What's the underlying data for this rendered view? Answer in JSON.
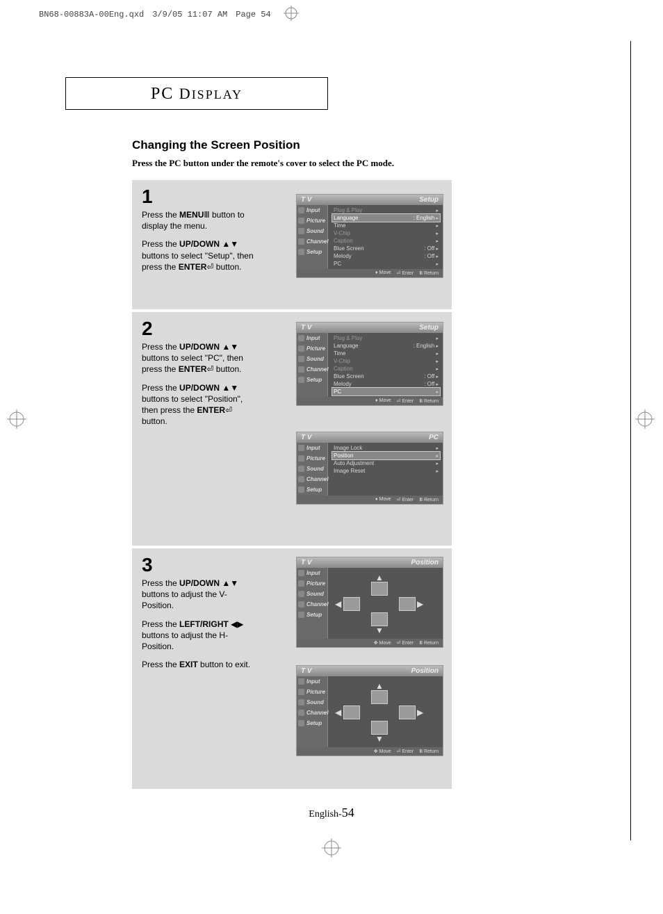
{
  "print_header": {
    "file": "BN68-00883A-00Eng.qxd",
    "date": "3/9/05 11:07 AM",
    "page_label": "Page 54"
  },
  "section_title": "PC Display",
  "subtitle": "Changing the Screen Position",
  "lead": "Press the PC button under the remote's cover to select the PC mode.",
  "footer": {
    "lang": "English-",
    "pn": "54"
  },
  "steps": {
    "s1": {
      "num": "1",
      "p1a": "Press the ",
      "p1b": "MENU",
      "p1c": " button to display the menu.",
      "p2a": "Press the ",
      "p2b": "UP/DOWN",
      "p2c": " buttons to select \"Setup\", then press the ",
      "p2d": "ENTER",
      "p2e": " button."
    },
    "s2": {
      "num": "2",
      "p1a": "Press the ",
      "p1b": "UP/DOWN",
      "p1c": " buttons to select \"PC\", then press the ",
      "p1d": "ENTER",
      "p1e": " button.",
      "p2a": "Press the ",
      "p2b": "UP/DOWN",
      "p2c": " buttons to select \"Position\", then press the ",
      "p2d": "ENTER",
      "p2e": " button."
    },
    "s3": {
      "num": "3",
      "p1a": "Press the ",
      "p1b": "UP/DOWN",
      "p1c": " buttons to adjust the V-Position.",
      "p2a": "Press the ",
      "p2b": "LEFT/RIGHT",
      "p2c": " buttons to adjust the H-Position.",
      "p3a": "Press the ",
      "p3b": "EXIT",
      "p3c": " button to exit."
    }
  },
  "osd": {
    "tv": "T V",
    "side": [
      "Input",
      "Picture",
      "Sound",
      "Channel",
      "Setup"
    ],
    "setup_title": "Setup",
    "pc_title": "PC",
    "position_title": "Position",
    "foot": {
      "move": "Move",
      "enter": "Enter",
      "return": "Return"
    },
    "setup_items": [
      {
        "label": "Plug & Play",
        "val": "",
        "dim": true
      },
      {
        "label": "Language",
        "val": ": English"
      },
      {
        "label": "Time",
        "val": ""
      },
      {
        "label": "V-Chip",
        "val": "",
        "dim": true
      },
      {
        "label": "Caption",
        "val": "",
        "dim": true
      },
      {
        "label": "Blue Screen",
        "val": ": Off"
      },
      {
        "label": "Melody",
        "val": ": Off"
      },
      {
        "label": "PC",
        "val": ""
      }
    ],
    "pc_items": [
      {
        "label": "Image Lock",
        "val": ""
      },
      {
        "label": "Position",
        "val": ""
      },
      {
        "label": "Auto Adjustment",
        "val": ""
      },
      {
        "label": "Image Reset",
        "val": ""
      }
    ]
  }
}
